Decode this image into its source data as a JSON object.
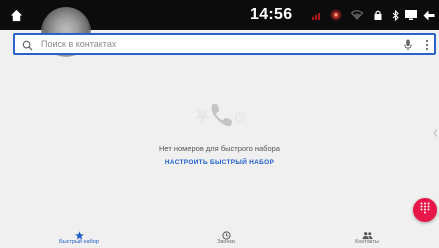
{
  "status_bar": {
    "time": "14:56",
    "icons": [
      "home-icon",
      "signal-icon",
      "app-status-icon",
      "wifi-icon",
      "lock-icon",
      "bluetooth-icon",
      "screen-icon",
      "back-icon"
    ]
  },
  "search": {
    "placeholder": "Поиск в контактах"
  },
  "empty_state": {
    "message": "Нет номеров для быстрого набора",
    "action_label": "НАСТРОИТЬ БЫСТРЫЙ НАБОР"
  },
  "bottom_nav": {
    "items": [
      {
        "label": "Быстрый набор",
        "icon": "star-icon",
        "active": true
      },
      {
        "label": "Звонки",
        "icon": "clock-icon",
        "active": false
      },
      {
        "label": "Контакты",
        "icon": "people-icon",
        "active": false
      }
    ]
  },
  "colors": {
    "accent": "#1e5fc9",
    "fab": "#e8174a",
    "status_bar": "#0c0c0c",
    "background": "#f0f0f0"
  }
}
